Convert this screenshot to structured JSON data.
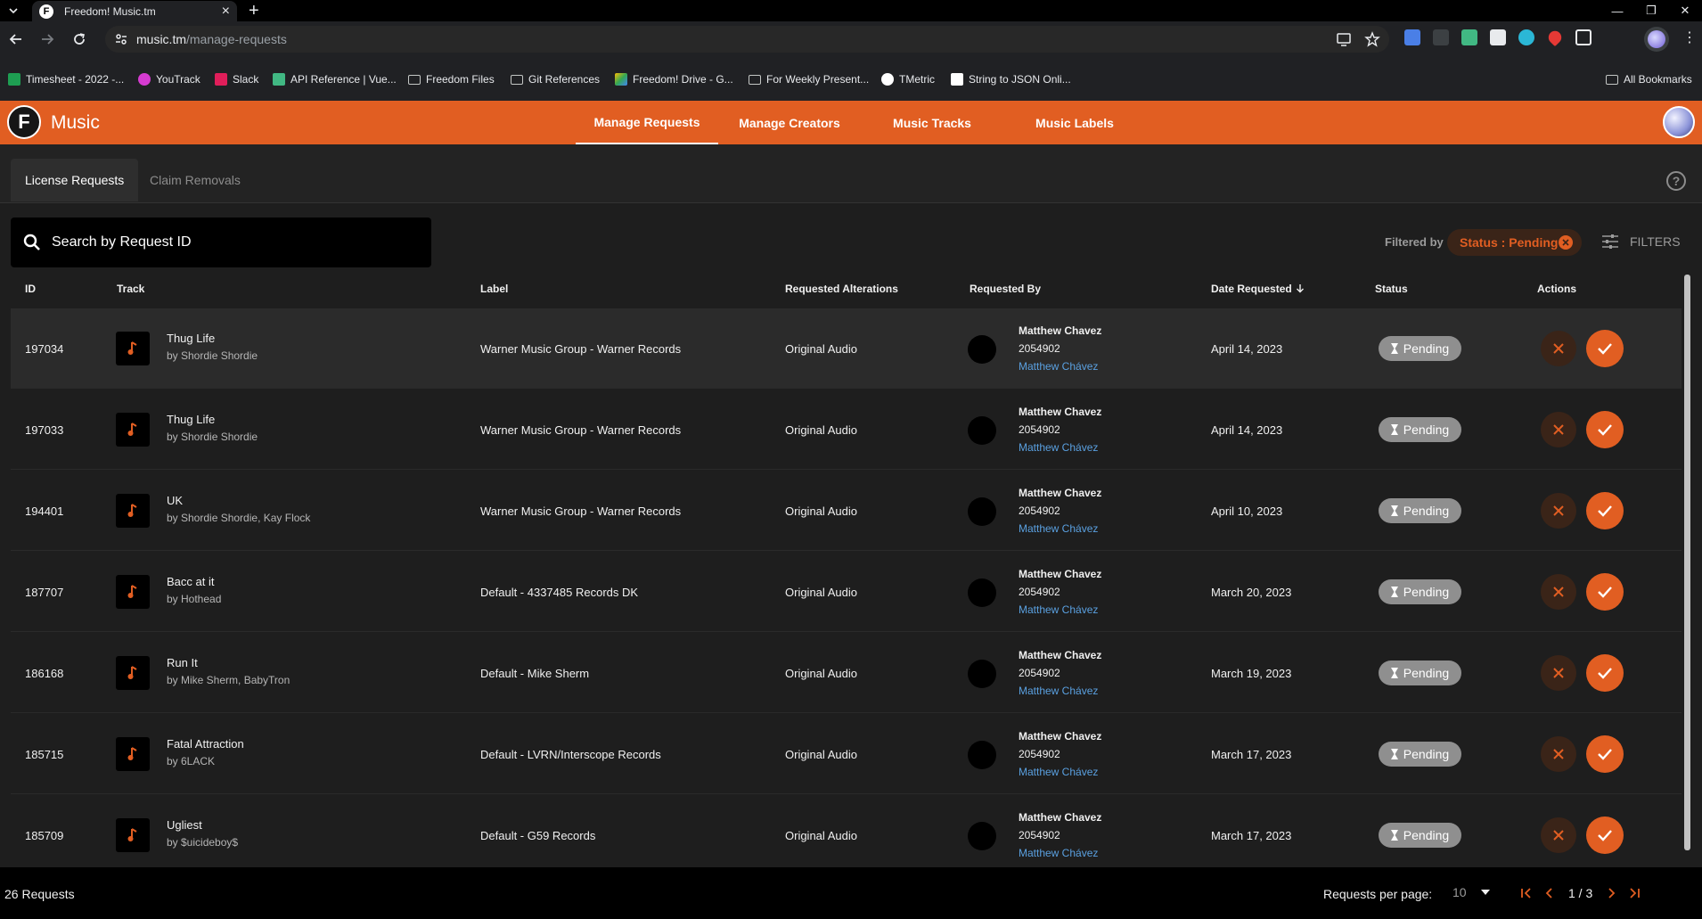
{
  "browser": {
    "tab_title": "Freedom! Music.tm",
    "tab_favicon": "F",
    "url_host": "music.tm",
    "url_path": "/manage-requests",
    "bookmarks": [
      {
        "label": "Timesheet - 2022 -...",
        "icon": "sheets-icon",
        "color": "#1e9e52"
      },
      {
        "label": "YouTrack",
        "icon": "youtrack-icon",
        "color": "#d63bd1"
      },
      {
        "label": "Slack",
        "icon": "slack-icon",
        "color": "#e01e5a"
      },
      {
        "label": "API Reference | Vue...",
        "icon": "vue-icon",
        "color": "#41b883"
      },
      {
        "label": "Freedom Files",
        "icon": "folder-icon",
        "color": "#c4c7c5"
      },
      {
        "label": "Git References",
        "icon": "folder-icon",
        "color": "#c4c7c5"
      },
      {
        "label": "Freedom! Drive - G...",
        "icon": "drive-icon",
        "color": "#fbbc04"
      },
      {
        "label": "For Weekly Present...",
        "icon": "folder-icon",
        "color": "#c4c7c5"
      },
      {
        "label": "TMetric",
        "icon": "tmetric-icon",
        "color": "#ffffff"
      },
      {
        "label": "String to JSON Onli...",
        "icon": "cb-icon",
        "color": "#ffffff"
      }
    ],
    "all_bookmarks": "All Bookmarks"
  },
  "app": {
    "logo": "F",
    "name": "Music",
    "nav": [
      "Manage Requests",
      "Manage Creators",
      "Music Tracks",
      "Music Labels"
    ],
    "active_nav": "Manage Requests",
    "accent": "#e15e22"
  },
  "subtabs": [
    "License Requests",
    "Claim Removals"
  ],
  "search": {
    "placeholder": "Search by Request ID"
  },
  "filters": {
    "filtered_by": "Filtered by",
    "chip": "Status : Pending",
    "button": "FILTERS"
  },
  "table": {
    "columns": [
      "ID",
      "Track",
      "Label",
      "Requested Alterations",
      "Requested By",
      "Date Requested",
      "Status",
      "Actions"
    ],
    "sorted_by": "Date Requested",
    "rows": [
      {
        "id": "197034",
        "title": "Thug Life",
        "artist": "by Shordie Shordie",
        "label": "Warner Music Group - Warner Records",
        "alteration": "Original Audio",
        "req_name": "Matthew Chavez",
        "req_id": "2054902",
        "req_link": "Matthew Chávez",
        "date": "April 14, 2023",
        "status": "Pending"
      },
      {
        "id": "197033",
        "title": "Thug Life",
        "artist": "by Shordie Shordie",
        "label": "Warner Music Group - Warner Records",
        "alteration": "Original Audio",
        "req_name": "Matthew Chavez",
        "req_id": "2054902",
        "req_link": "Matthew Chávez",
        "date": "April 14, 2023",
        "status": "Pending"
      },
      {
        "id": "194401",
        "title": "UK",
        "artist": "by Shordie Shordie, Kay Flock",
        "label": "Warner Music Group - Warner Records",
        "alteration": "Original Audio",
        "req_name": "Matthew Chavez",
        "req_id": "2054902",
        "req_link": "Matthew Chávez",
        "date": "April 10, 2023",
        "status": "Pending"
      },
      {
        "id": "187707",
        "title": "Bacc at it",
        "artist": "by Hothead",
        "label": "Default - 4337485 Records DK",
        "alteration": "Original Audio",
        "req_name": "Matthew Chavez",
        "req_id": "2054902",
        "req_link": "Matthew Chávez",
        "date": "March 20, 2023",
        "status": "Pending"
      },
      {
        "id": "186168",
        "title": "Run It",
        "artist": "by Mike Sherm, BabyTron",
        "label": "Default - Mike Sherm",
        "alteration": "Original Audio",
        "req_name": "Matthew Chavez",
        "req_id": "2054902",
        "req_link": "Matthew Chávez",
        "date": "March 19, 2023",
        "status": "Pending"
      },
      {
        "id": "185715",
        "title": "Fatal Attraction",
        "artist": "by 6LACK",
        "label": "Default - LVRN/Interscope Records",
        "alteration": "Original Audio",
        "req_name": "Matthew Chavez",
        "req_id": "2054902",
        "req_link": "Matthew Chávez",
        "date": "March 17, 2023",
        "status": "Pending"
      },
      {
        "id": "185709",
        "title": "Ugliest",
        "artist": "by $uicideboy$",
        "label": "Default - G59 Records",
        "alteration": "Original Audio",
        "req_name": "Matthew Chavez",
        "req_id": "2054902",
        "req_link": "Matthew Chávez",
        "date": "March 17, 2023",
        "status": "Pending"
      }
    ]
  },
  "footer": {
    "total": "26 Requests",
    "rpp_label": "Requests per page:",
    "rpp_value": "10",
    "page": "1 / 3"
  }
}
